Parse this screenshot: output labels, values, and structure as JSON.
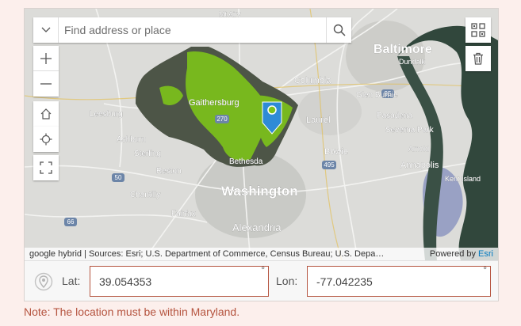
{
  "map": {
    "search_placeholder": "Find address or place",
    "place_labels": [
      "Baltimore",
      "Washington",
      "Alexandria",
      "Gaithersburg",
      "Columbia",
      "Annapolis",
      "Bowie",
      "Laurel",
      "Leesburg",
      "Ashburn",
      "Sterling",
      "Reston",
      "Chantilly",
      "Fairfax",
      "Bethesda",
      "Glen Burnie",
      "Pasadena",
      "Severna Park",
      "Kent Island",
      "Mt Airy",
      "Dundalk",
      "Arnold"
    ],
    "shield_labels": [
      "270",
      "495",
      "95",
      "66",
      "50"
    ],
    "attribution_sources": "google hybrid | Sources: Esri; U.S. Department of Commerce, Census Bureau; U.S. Depa…",
    "powered_by_text": "Powered by",
    "powered_by_brand": "Esri",
    "controls": [
      "zoom-in",
      "zoom-out",
      "home",
      "locate",
      "fullscreen",
      "basemap-gallery",
      "clear"
    ]
  },
  "coords": {
    "lat_label": "Lat:",
    "lat_value": "39.054353",
    "lon_label": "Lon:",
    "lon_value": "-77.042235",
    "degree_symbol": "°"
  },
  "note": "Note: The location must be within Maryland.",
  "colors": {
    "error": "#b5543f",
    "accent_marker": "#2e8bd6",
    "vegetation": "#7dc31a",
    "water": "#2f4a3e"
  }
}
